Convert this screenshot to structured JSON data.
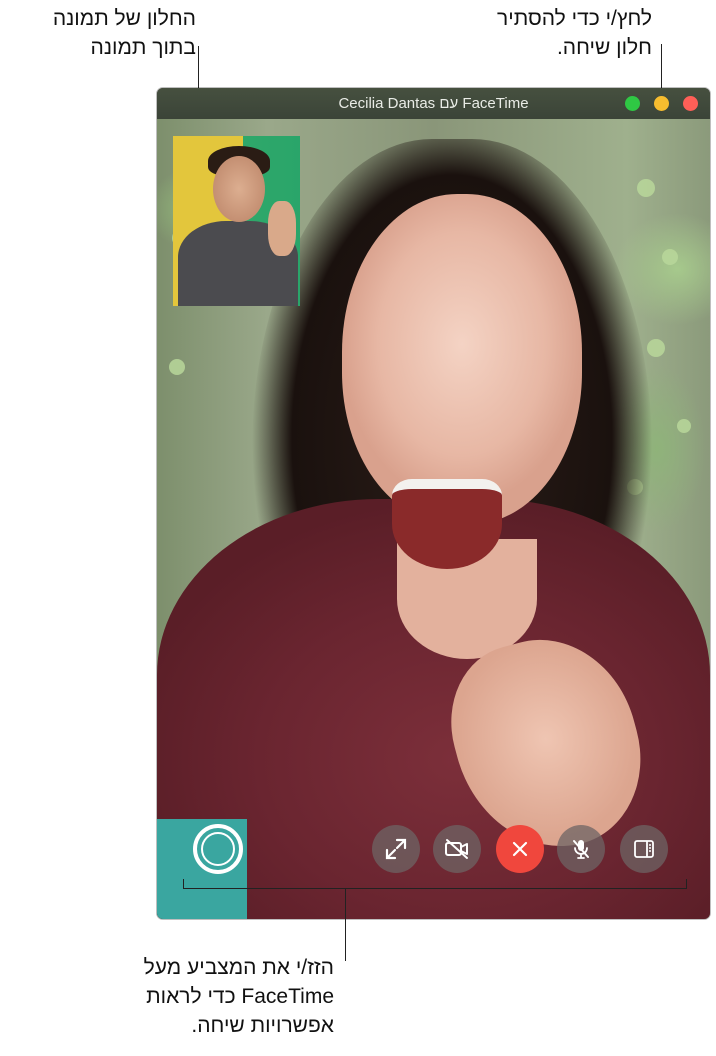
{
  "callouts": {
    "pip": [
      "החלון של תמונה",
      "בתוך תמונה"
    ],
    "hide": [
      "לחץ/י כדי להסתיר",
      "חלון שיחה."
    ],
    "options": [
      "הזז/י את המצביע מעל",
      "FaceTime כדי לראות",
      "אפשרויות שיחה."
    ]
  },
  "window": {
    "title": "Cecilia Dantas עם FaceTime",
    "traffic_lights": {
      "green": "#2fc844",
      "yellow": "#f7bd2f",
      "red": "#fe5f57"
    }
  },
  "controls": {
    "buttons": [
      {
        "name": "fullscreen-icon"
      },
      {
        "name": "video-off-icon"
      },
      {
        "name": "end-call-icon",
        "color": "#f0473d"
      },
      {
        "name": "mute-mic-icon"
      },
      {
        "name": "sidebar-icon"
      }
    ],
    "shutter": "shutter-icon"
  }
}
